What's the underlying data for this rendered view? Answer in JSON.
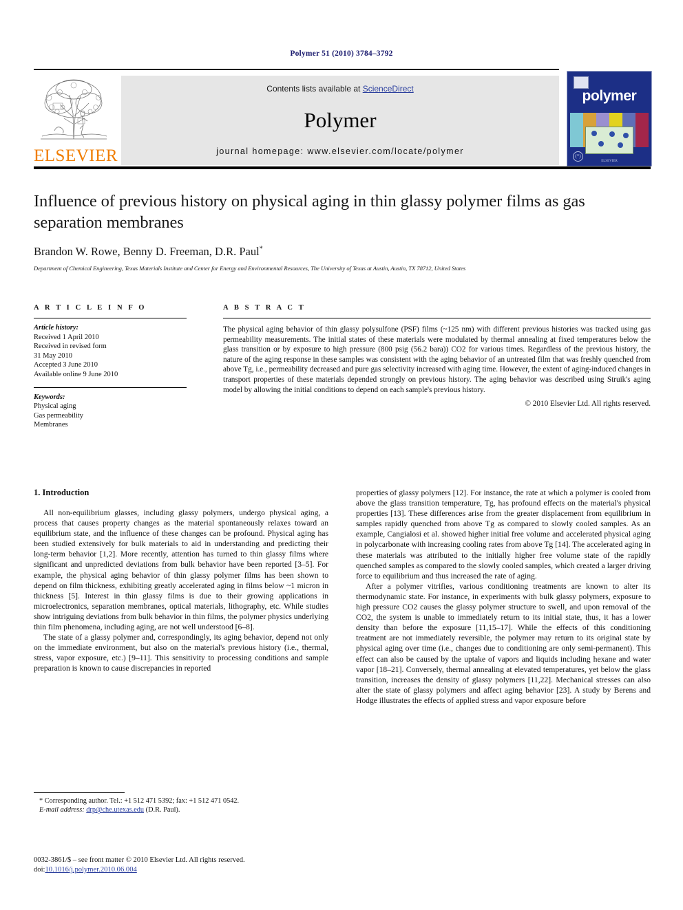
{
  "running_head": "Polymer 51 (2010) 3784–3792",
  "masthead": {
    "contents_prefix": "Contents lists available at ",
    "sciencedirect": "ScienceDirect",
    "journal_title": "Polymer",
    "homepage": "journal homepage: www.elsevier.com/locate/polymer",
    "publisher_logo_text": "ELSEVIER",
    "cover_word": "polymer",
    "cover_footer": "ELSEVIER"
  },
  "article": {
    "title": "Influence of previous history on physical aging in thin glassy polymer films as gas separation membranes",
    "authors": "Brandon W. Rowe, Benny D. Freeman, D.R. Paul",
    "corresponding_marker": "*",
    "affiliation": "Department of Chemical Engineering, Texas Materials Institute and Center for Energy and Environmental Resources, The University of Texas at Austin, Austin, TX 78712, United States"
  },
  "article_info": {
    "heading": "A R T I C L E   I N F O",
    "history_label": "Article history:",
    "history": [
      "Received 1 April 2010",
      "Received in revised form",
      "31 May 2010",
      "Accepted 3 June 2010",
      "Available online 9 June 2010"
    ],
    "keywords_label": "Keywords:",
    "keywords": [
      "Physical aging",
      "Gas permeability",
      "Membranes"
    ]
  },
  "abstract": {
    "heading": "A B S T R A C T",
    "text": "The physical aging behavior of thin glassy polysulfone (PSF) films (~125 nm) with different previous histories was tracked using gas permeability measurements. The initial states of these materials were modulated by thermal annealing at fixed temperatures below the glass transition or by exposure to high pressure (800 psig (56.2 bara)) CO2 for various times. Regardless of the previous history, the nature of the aging response in these samples was consistent with the aging behavior of an untreated film that was freshly quenched from above Tg, i.e., permeability decreased and pure gas selectivity increased with aging time. However, the extent of aging-induced changes in transport properties of these materials depended strongly on previous history. The aging behavior was described using Struik's aging model by allowing the initial conditions to depend on each sample's previous history.",
    "copyright": "© 2010 Elsevier Ltd. All rights reserved."
  },
  "body": {
    "section_number_title": "1. Introduction",
    "left_paragraphs": [
      "All non-equilibrium glasses, including glassy polymers, undergo physical aging, a process that causes property changes as the material spontaneously relaxes toward an equilibrium state, and the influence of these changes can be profound. Physical aging has been studied extensively for bulk materials to aid in understanding and predicting their long-term behavior [1,2]. More recently, attention has turned to thin glassy films where significant and unpredicted deviations from bulk behavior have been reported [3–5]. For example, the physical aging behavior of thin glassy polymer films has been shown to depend on film thickness, exhibiting greatly accelerated aging in films below ~1 micron in thickness [5]. Interest in thin glassy films is due to their growing applications in microelectronics, separation membranes, optical materials, lithography, etc. While studies show intriguing deviations from bulk behavior in thin films, the polymer physics underlying thin film phenomena, including aging, are not well understood [6–8].",
      "The state of a glassy polymer and, correspondingly, its aging behavior, depend not only on the immediate environment, but also on the material's previous history (i.e., thermal, stress, vapor exposure, etc.) [9–11]. This sensitivity to processing conditions and sample preparation is known to cause discrepancies in reported"
    ],
    "right_paragraphs": [
      "properties of glassy polymers [12]. For instance, the rate at which a polymer is cooled from above the glass transition temperature, Tg, has profound effects on the material's physical properties [13]. These differences arise from the greater displacement from equilibrium in samples rapidly quenched from above Tg as compared to slowly cooled samples. As an example, Cangialosi et al. showed higher initial free volume and accelerated physical aging in polycarbonate with increasing cooling rates from above Tg [14]. The accelerated aging in these materials was attributed to the initially higher free volume state of the rapidly quenched samples as compared to the slowly cooled samples, which created a larger driving force to equilibrium and thus increased the rate of aging.",
      "After a polymer vitrifies, various conditioning treatments are known to alter its thermodynamic state. For instance, in experiments with bulk glassy polymers, exposure to high pressure CO2 causes the glassy polymer structure to swell, and upon removal of the CO2, the system is unable to immediately return to its initial state, thus, it has a lower density than before the exposure [11,15–17]. While the effects of this conditioning treatment are not immediately reversible, the polymer may return to its original state by physical aging over time (i.e., changes due to conditioning are only semi-permanent). This effect can also be caused by the uptake of vapors and liquids including hexane and water vapor [18–21]. Conversely, thermal annealing at elevated temperatures, yet below the glass transition, increases the density of glassy polymers [11,22]. Mechanical stresses can also alter the state of glassy polymers and affect aging behavior [23]. A study by Berens and Hodge illustrates the effects of applied stress and vapor exposure before"
    ]
  },
  "footnote": {
    "corresponding": "* Corresponding author. Tel.: +1 512 471 5392; fax: +1 512 471 0542.",
    "email_label": "E-mail address:",
    "email": "drp@che.utexas.edu",
    "email_suffix": "(D.R. Paul)."
  },
  "issn_line": {
    "text": "0032-3861/$ – see front matter © 2010 Elsevier Ltd. All rights reserved.",
    "doi_label": "doi:",
    "doi": "10.1016/j.polymer.2010.06.004"
  },
  "colors": {
    "link": "#2b3f9e",
    "running_head": "#1a1a6e",
    "elsevier_orange": "#F07D00",
    "cover_blue": "#1c2f86",
    "masthead_grey": "#e6e6e6"
  }
}
